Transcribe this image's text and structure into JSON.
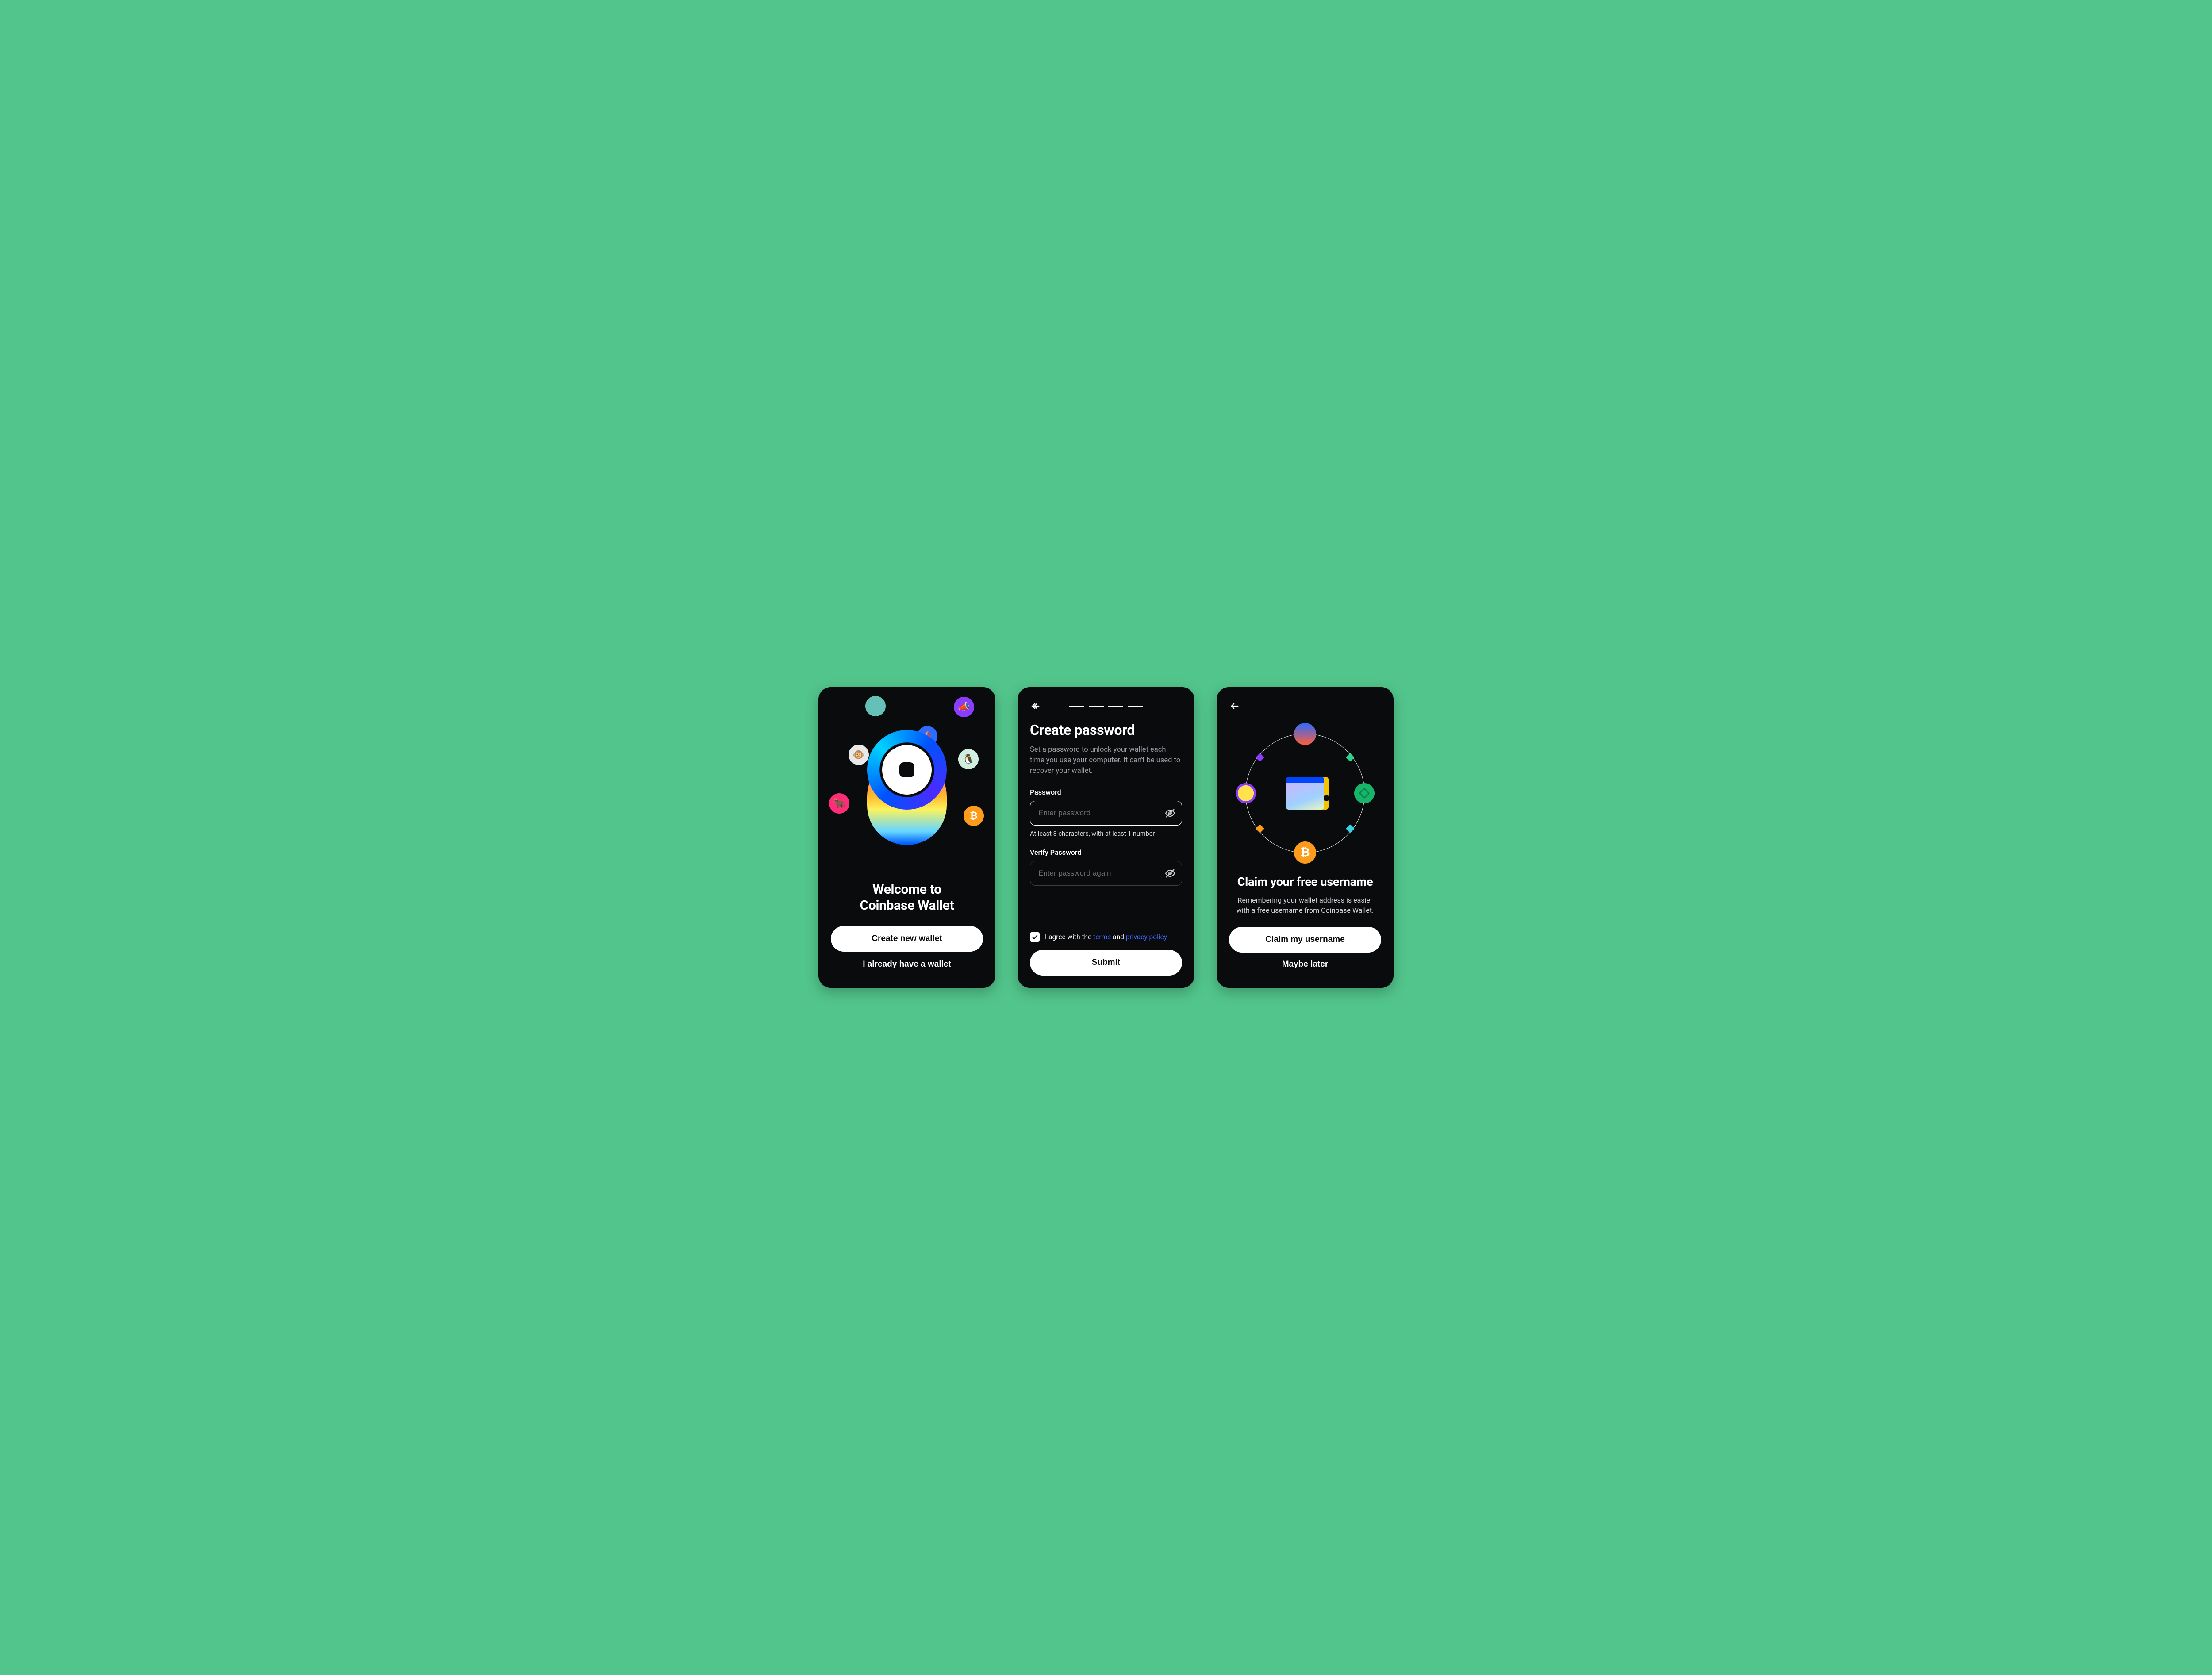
{
  "colors": {
    "accent_blue": "#0052ff",
    "link_blue": "#4169ff",
    "bg_black": "#0a0b0d",
    "bg_green": "#52c58c"
  },
  "screen1": {
    "title_line1": "Welcome to",
    "title_line2": "Coinbase Wallet",
    "create_btn": "Create new wallet",
    "existing_btn": "I already have a wallet",
    "orbit_icons": [
      {
        "name": "avatar-1",
        "bg": "#65c1b8"
      },
      {
        "name": "megaphone",
        "bg": "#8a3cff"
      },
      {
        "name": "ape",
        "bg": "#e6e6e6"
      },
      {
        "name": "ship",
        "bg": "#2d6cff"
      },
      {
        "name": "penguin",
        "bg": "#8fe3b2"
      },
      {
        "name": "bull",
        "bg": "#ff2d78"
      },
      {
        "name": "bitcoin",
        "bg": "#ff9b1a"
      }
    ]
  },
  "screen2": {
    "steps_total": 4,
    "title": "Create password",
    "description": "Set a password to unlock your wallet each time you use your computer. It can't be used to recover your wallet.",
    "password_label": "Password",
    "password_placeholder": "Enter password",
    "password_hint": "At least 8 characters, with at least 1 number",
    "verify_label": "Verify Password",
    "verify_placeholder": "Enter password again",
    "agree_pre": "I agree with the ",
    "agree_terms": "terms",
    "agree_mid": " and ",
    "agree_privacy": "privacy policy",
    "agree_checked": true,
    "submit_btn": "Submit"
  },
  "screen3": {
    "title": "Claim your free username",
    "description": "Remembering your wallet address is easier with a free username from Coinbase Wallet.",
    "claim_btn": "Claim my username",
    "later_btn": "Maybe later"
  }
}
